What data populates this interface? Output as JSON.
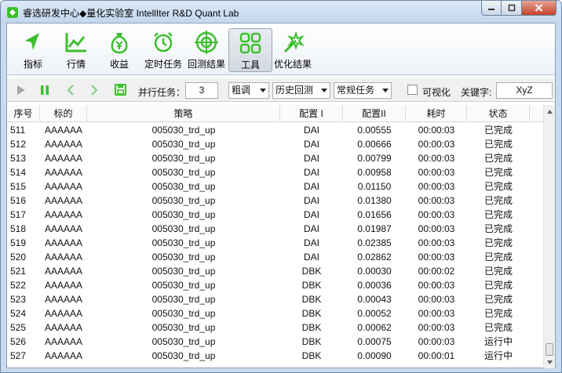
{
  "window": {
    "title": "睿选研发中心◆量化实验室 IntellIter R&D Quant Lab"
  },
  "colors": {
    "accent": "#3cbf2c",
    "title_bar": "#c9daee"
  },
  "toolbar": [
    {
      "label": "指标",
      "icon": "cursor-arrow-icon"
    },
    {
      "label": "行情",
      "icon": "line-chart-icon"
    },
    {
      "label": "收益",
      "icon": "money-bag-icon"
    },
    {
      "label": "定时任务",
      "icon": "alarm-clock-icon"
    },
    {
      "label": "回测结果",
      "icon": "target-icon"
    },
    {
      "label": "工具",
      "icon": "grid-tools-icon",
      "active": true
    },
    {
      "label": "优化结果",
      "icon": "magic-wand-icon"
    }
  ],
  "controls": {
    "parallel_label": "并行任务：",
    "parallel_value": "3",
    "mode": "粗调",
    "source": "历史回测",
    "task_type": "常规任务",
    "visualize_label": "可视化",
    "visualize_checked": false,
    "keyword_label": "关键字:",
    "keyword_value": "XyZ"
  },
  "table": {
    "headers": [
      "序号",
      "标的",
      "策略",
      "配置 I",
      "配置II",
      "耗时",
      "状态"
    ],
    "rows": [
      [
        "511",
        "AAAAAA",
        "005030_trd_up",
        "DAI",
        "0.00555",
        "00:00:03",
        "已完成"
      ],
      [
        "512",
        "AAAAAA",
        "005030_trd_up",
        "DAI",
        "0.00666",
        "00:00:03",
        "已完成"
      ],
      [
        "513",
        "AAAAAA",
        "005030_trd_up",
        "DAI",
        "0.00799",
        "00:00:03",
        "已完成"
      ],
      [
        "514",
        "AAAAAA",
        "005030_trd_up",
        "DAI",
        "0.00958",
        "00:00:03",
        "已完成"
      ],
      [
        "515",
        "AAAAAA",
        "005030_trd_up",
        "DAI",
        "0.01150",
        "00:00:03",
        "已完成"
      ],
      [
        "516",
        "AAAAAA",
        "005030_trd_up",
        "DAI",
        "0.01380",
        "00:00:03",
        "已完成"
      ],
      [
        "517",
        "AAAAAA",
        "005030_trd_up",
        "DAI",
        "0.01656",
        "00:00:03",
        "已完成"
      ],
      [
        "518",
        "AAAAAA",
        "005030_trd_up",
        "DAI",
        "0.01987",
        "00:00:03",
        "已完成"
      ],
      [
        "519",
        "AAAAAA",
        "005030_trd_up",
        "DAI",
        "0.02385",
        "00:00:03",
        "已完成"
      ],
      [
        "520",
        "AAAAAA",
        "005030_trd_up",
        "DAI",
        "0.02862",
        "00:00:03",
        "已完成"
      ],
      [
        "521",
        "AAAAAA",
        "005030_trd_up",
        "DBK",
        "0.00030",
        "00:00:02",
        "已完成"
      ],
      [
        "522",
        "AAAAAA",
        "005030_trd_up",
        "DBK",
        "0.00036",
        "00:00:03",
        "已完成"
      ],
      [
        "523",
        "AAAAAA",
        "005030_trd_up",
        "DBK",
        "0.00043",
        "00:00:03",
        "已完成"
      ],
      [
        "524",
        "AAAAAA",
        "005030_trd_up",
        "DBK",
        "0.00052",
        "00:00:03",
        "已完成"
      ],
      [
        "525",
        "AAAAAA",
        "005030_trd_up",
        "DBK",
        "0.00062",
        "00:00:03",
        "已完成"
      ],
      [
        "526",
        "AAAAAA",
        "005030_trd_up",
        "DBK",
        "0.00075",
        "00:00:03",
        "运行中"
      ],
      [
        "527",
        "AAAAAA",
        "005030_trd_up",
        "DBK",
        "0.00090",
        "00:00:01",
        "运行中"
      ]
    ]
  }
}
